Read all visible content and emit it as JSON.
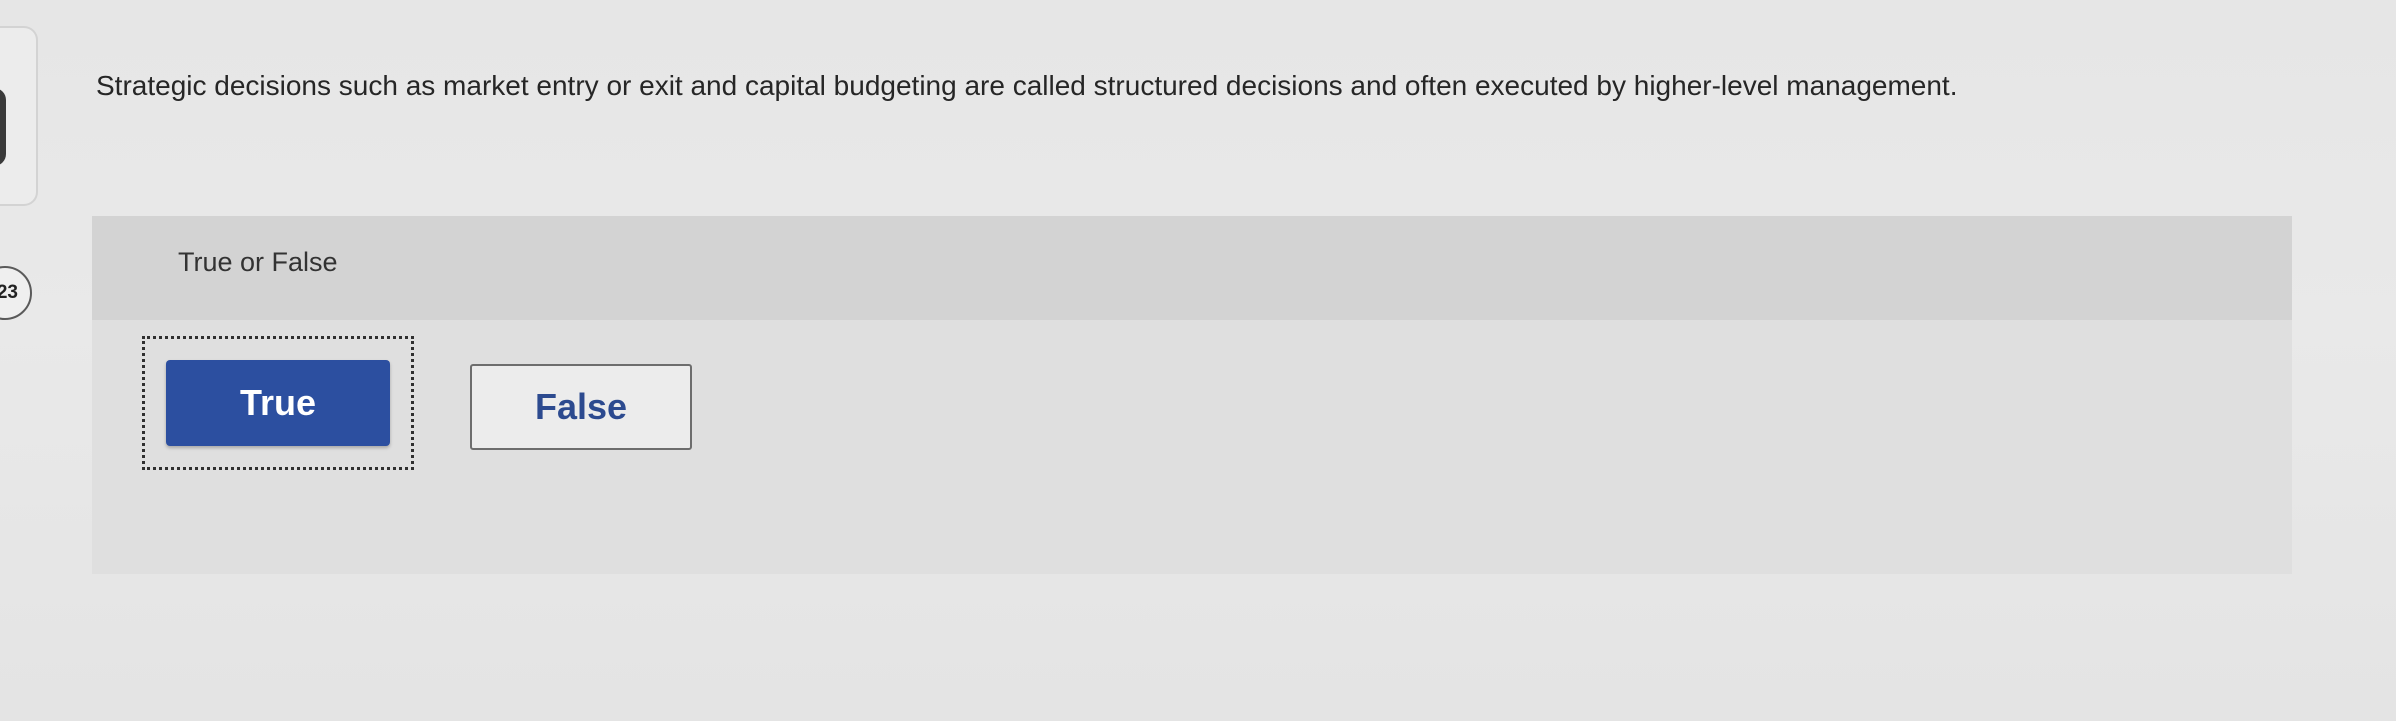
{
  "sidebar": {
    "question_number": "23"
  },
  "question": {
    "text": "Strategic decisions such as market entry or exit and capital budgeting are called structured decisions and often executed by higher-level management."
  },
  "answer_panel": {
    "header": "True or False",
    "options": [
      {
        "label": "True",
        "selected": true
      },
      {
        "label": "False",
        "selected": false
      }
    ]
  },
  "colors": {
    "selected_button_bg": "#2c4fa0",
    "unselected_button_text": "#2c4a8f"
  }
}
